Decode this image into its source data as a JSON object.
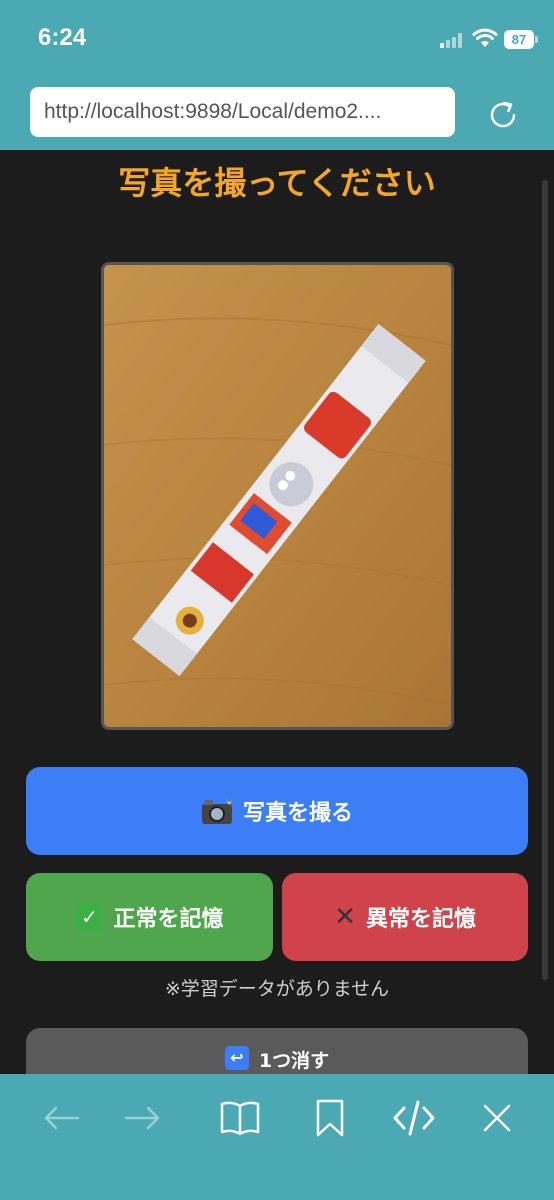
{
  "status_bar": {
    "time": "6:24",
    "battery": "87",
    "icons": [
      "signal-icon",
      "wifi-icon",
      "battery-icon"
    ]
  },
  "browser": {
    "url": "http://localhost:9898/Local/demo2....",
    "reload_icon": "reload-icon",
    "toolbar": [
      "back-arrow-icon",
      "forward-arrow-icon",
      "book-icon",
      "bookmark-icon",
      "code-icon",
      "close-icon"
    ]
  },
  "page": {
    "title": "写真を撮ってください",
    "capture_button": "写真を撮る",
    "capture_icon": "camera-flash-icon",
    "normal_button": "正常を記憶",
    "normal_icon": "check-mark-icon",
    "abnormal_button": "異常を記憶",
    "abnormal_icon": "x-mark-icon",
    "hint": "※学習データがありません",
    "undo_button": "1つ消す",
    "undo_icon": "return-arrow-icon"
  },
  "colors": {
    "chrome": "#4aa9b2",
    "title": "#f5a623",
    "capture": "#3b7ef5",
    "normal": "#4fa64c",
    "abnormal": "#d0434a",
    "undo": "#5a5a5a"
  }
}
